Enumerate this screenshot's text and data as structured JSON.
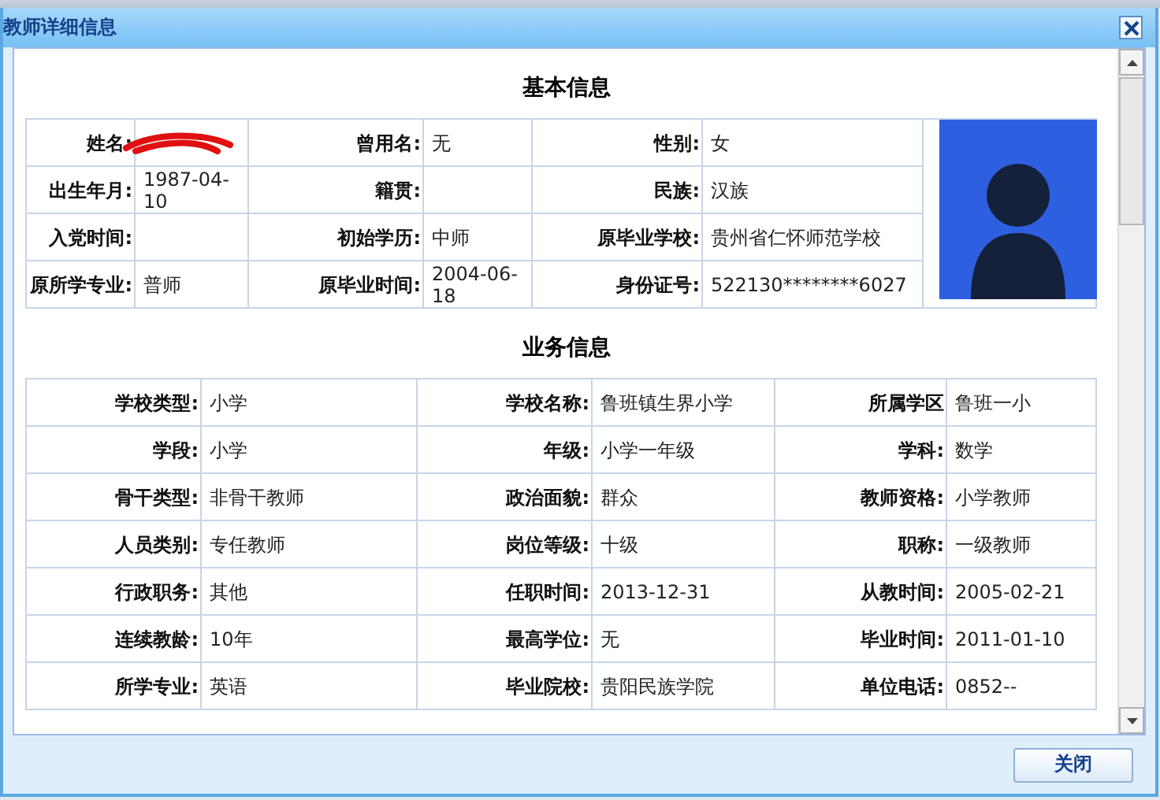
{
  "window": {
    "title": "教师详细信息"
  },
  "basic_info": {
    "title": "基本信息",
    "rows": [
      [
        {
          "label": "姓名:"
        },
        {
          "label": "曾用名:",
          "value": "无"
        },
        {
          "label": "性别:",
          "value": "女"
        }
      ],
      [
        {
          "label": "出生年月:",
          "value": "1987-04-10"
        },
        {
          "label": "籍贯:"
        },
        {
          "label": "民族:",
          "value": "汉族"
        }
      ],
      [
        {
          "label": "入党时间:"
        },
        {
          "label": "初始学历:",
          "value": "中师"
        },
        {
          "label": "原毕业学校:",
          "value": "贵州省仁怀师范学校"
        }
      ],
      [
        {
          "label": "原所学专业:",
          "value": "普师"
        },
        {
          "label": "原毕业时间:",
          "value": "2004-06-18"
        },
        {
          "label": "身份证号:",
          "value": "522130********6027"
        }
      ]
    ]
  },
  "business_info": {
    "title": "业务信息",
    "rows": [
      [
        {
          "label": "学校类型:",
          "value": "小学"
        },
        {
          "label": "学校名称:",
          "value": "鲁班镇生界小学"
        },
        {
          "label": "所属学区",
          "value": "鲁班一小"
        }
      ],
      [
        {
          "label": "学段:",
          "value": "小学"
        },
        {
          "label": "年级:",
          "value": "小学一年级"
        },
        {
          "label": "学科:",
          "value": "数学"
        }
      ],
      [
        {
          "label": "骨干类型:",
          "value": "非骨干教师"
        },
        {
          "label": "政治面貌:",
          "value": "群众"
        },
        {
          "label": "教师资格:",
          "value": "小学教师"
        }
      ],
      [
        {
          "label": "人员类别:",
          "value": "专任教师"
        },
        {
          "label": "岗位等级:",
          "value": "十级"
        },
        {
          "label": "职称:",
          "value": "一级教师"
        }
      ],
      [
        {
          "label": "行政职务:",
          "value": "其他"
        },
        {
          "label": "任职时间:",
          "value": "2013-12-31"
        },
        {
          "label": "从教时间:",
          "value": "2005-02-21"
        }
      ],
      [
        {
          "label": "连续教龄:",
          "value": "10年"
        },
        {
          "label": "最高学位:",
          "value": "无"
        },
        {
          "label": "毕业时间:",
          "value": "2011-01-10"
        }
      ],
      [
        {
          "label": "所学专业:",
          "value": "英语"
        },
        {
          "label": "毕业院校:",
          "value": "贵阳民族学院"
        },
        {
          "label": "单位电话:",
          "value": "0852--"
        }
      ]
    ]
  },
  "footer": {
    "button": "关闭"
  }
}
